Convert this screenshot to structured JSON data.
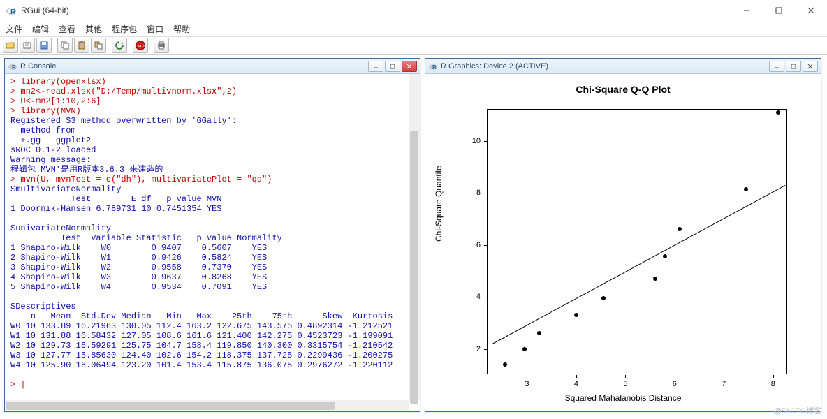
{
  "window": {
    "title": "RGui (64-bit)"
  },
  "menu": [
    "文件",
    "编辑",
    "查看",
    "其他",
    "程序包",
    "窗口",
    "帮助"
  ],
  "mdi": {
    "console": {
      "title": "R Console"
    },
    "graphics": {
      "title": "R Graphics: Device 2 (ACTIVE)"
    }
  },
  "console_lines": [
    {
      "cls": "red",
      "text": "> library(openxlsx)"
    },
    {
      "cls": "red",
      "text": "> mn2<-read.xlsx(\"D:/Temp/multivnorm.xlsx\",2)"
    },
    {
      "cls": "red",
      "text": "> U<-mn2[1:10,2:6]"
    },
    {
      "cls": "red",
      "text": "> library(MVN)"
    },
    {
      "cls": "blue",
      "text": "Registered S3 method overwritten by 'GGally':"
    },
    {
      "cls": "blue",
      "text": "  method from   "
    },
    {
      "cls": "blue",
      "text": "  +.gg   ggplot2"
    },
    {
      "cls": "blue",
      "text": "sROC 0.1-2 loaded"
    },
    {
      "cls": "blue",
      "text": "Warning message:"
    },
    {
      "cls": "blue",
      "text": "程辑包'MVN'是用R版本3.6.3 来建造的 "
    },
    {
      "cls": "red",
      "text": "> mvn(U, mvnTest = c(\"dh\"), multivariatePlot = \"qq\")"
    },
    {
      "cls": "blue",
      "text": "$multivariateNormality"
    },
    {
      "cls": "blue",
      "text": "            Test        E df   p value MVN"
    },
    {
      "cls": "blue",
      "text": "1 Doornik-Hansen 6.789731 10 0.7451354 YES"
    },
    {
      "cls": "blue",
      "text": ""
    },
    {
      "cls": "blue",
      "text": "$univariateNormality"
    },
    {
      "cls": "blue",
      "text": "          Test  Variable Statistic   p value Normality"
    },
    {
      "cls": "blue",
      "text": "1 Shapiro-Wilk    W0        0.9407    0.5607    YES   "
    },
    {
      "cls": "blue",
      "text": "2 Shapiro-Wilk    W1        0.9426    0.5824    YES   "
    },
    {
      "cls": "blue",
      "text": "3 Shapiro-Wilk    W2        0.9558    0.7370    YES   "
    },
    {
      "cls": "blue",
      "text": "4 Shapiro-Wilk    W3        0.9637    0.8268    YES   "
    },
    {
      "cls": "blue",
      "text": "5 Shapiro-Wilk    W4        0.9534    0.7091    YES   "
    },
    {
      "cls": "blue",
      "text": ""
    },
    {
      "cls": "blue",
      "text": "$Descriptives"
    },
    {
      "cls": "blue",
      "text": "    n   Mean  Std.Dev Median   Min   Max    25th    75th      Skew  Kurtosis"
    },
    {
      "cls": "blue",
      "text": "W0 10 133.89 16.21963 130.05 112.4 163.2 122.675 143.575 0.4892314 -1.212521"
    },
    {
      "cls": "blue",
      "text": "W1 10 131.88 16.58432 127.05 108.6 161.6 121.400 142.275 0.4523723 -1.199091"
    },
    {
      "cls": "blue",
      "text": "W2 10 129.73 16.59291 125.75 104.7 158.4 119.850 140.300 0.3315754 -1.210542"
    },
    {
      "cls": "blue",
      "text": "W3 10 127.77 15.85630 124.40 102.6 154.2 118.375 137.725 0.2299436 -1.200275"
    },
    {
      "cls": "blue",
      "text": "W4 10 125.90 16.06494 123.20 101.4 153.4 115.875 136.075 0.2976272 -1.220112"
    },
    {
      "cls": "blue",
      "text": ""
    },
    {
      "cls": "red",
      "text": "> "
    }
  ],
  "chart_data": {
    "type": "scatter",
    "title": "Chi-Square Q-Q Plot",
    "xlabel": "Squared Mahalanobis Distance",
    "ylabel": "Chi-Square Quantile",
    "xlim": [
      2.2,
      8.3
    ],
    "ylim": [
      1.0,
      11.2
    ],
    "x_ticks": [
      3,
      4,
      5,
      6,
      7,
      8
    ],
    "y_ticks": [
      2,
      4,
      6,
      8,
      10
    ],
    "points": [
      {
        "x": 2.55,
        "y": 1.4
      },
      {
        "x": 2.95,
        "y": 2.0
      },
      {
        "x": 3.25,
        "y": 2.6
      },
      {
        "x": 4.0,
        "y": 3.3
      },
      {
        "x": 4.55,
        "y": 3.95
      },
      {
        "x": 5.6,
        "y": 4.7
      },
      {
        "x": 5.8,
        "y": 5.55
      },
      {
        "x": 6.1,
        "y": 6.6
      },
      {
        "x": 7.45,
        "y": 8.15
      },
      {
        "x": 8.1,
        "y": 11.1
      }
    ],
    "qq_line": {
      "x1": 2.3,
      "y1": 2.2,
      "x2": 8.25,
      "y2": 8.3
    }
  },
  "watermark": "@51CTO博客"
}
